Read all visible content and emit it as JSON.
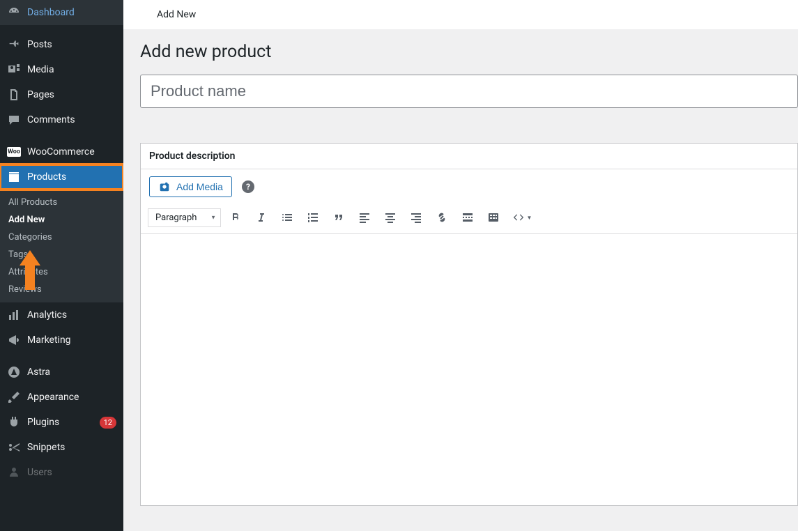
{
  "topbar": {
    "breadcrumb": "Add New"
  },
  "sidebar": {
    "items": [
      {
        "label": "Dashboard"
      },
      {
        "label": "Posts"
      },
      {
        "label": "Media"
      },
      {
        "label": "Pages"
      },
      {
        "label": "Comments"
      },
      {
        "label": "WooCommerce"
      },
      {
        "label": "Products"
      },
      {
        "label": "Analytics"
      },
      {
        "label": "Marketing"
      },
      {
        "label": "Astra"
      },
      {
        "label": "Appearance"
      },
      {
        "label": "Plugins",
        "badge": "12"
      },
      {
        "label": "Snippets"
      },
      {
        "label": "Users"
      }
    ],
    "submenu": [
      {
        "label": "All Products"
      },
      {
        "label": "Add New",
        "current": true
      },
      {
        "label": "Categories"
      },
      {
        "label": "Tags"
      },
      {
        "label": "Attributes"
      },
      {
        "label": "Reviews"
      }
    ]
  },
  "page": {
    "title": "Add new product",
    "product_name_placeholder": "Product name"
  },
  "editor": {
    "panel_title": "Product description",
    "add_media_label": "Add Media",
    "paragraph_label": "Paragraph",
    "help_glyph": "?"
  },
  "toolbar": {
    "buttons": [
      "bold",
      "italic",
      "bulleted-list",
      "numbered-list",
      "blockquote",
      "align-left",
      "align-center",
      "align-right",
      "link",
      "read-more",
      "toolbar-toggle",
      "code"
    ]
  }
}
